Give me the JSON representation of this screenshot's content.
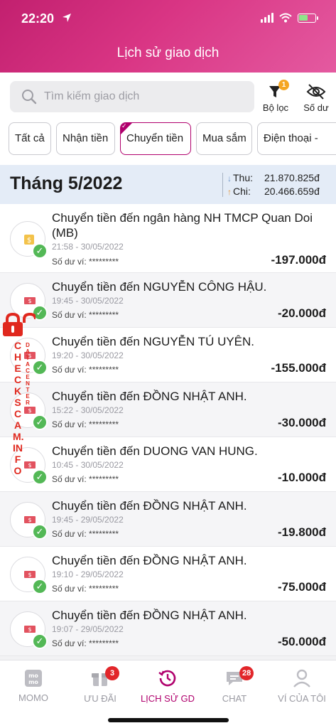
{
  "status_bar": {
    "time": "22:20"
  },
  "header": {
    "title": "Lịch sử giao dịch"
  },
  "search": {
    "placeholder": "Tìm kiếm giao dịch",
    "value": ""
  },
  "toolbar": {
    "filter_label": "Bộ lọc",
    "filter_badge": "1",
    "balance_label": "Số dư"
  },
  "chips": [
    {
      "label": "Tất cả",
      "active": false
    },
    {
      "label": "Nhận tiền",
      "active": false
    },
    {
      "label": "Chuyển tiền",
      "active": true
    },
    {
      "label": "Mua sắm",
      "active": false
    },
    {
      "label": "Điện thoại - ",
      "active": false
    }
  ],
  "month": {
    "title": "Tháng 5/2022",
    "income_label": "Thu:",
    "income_value": "21.870.825đ",
    "expense_label": "Chi:",
    "expense_value": "20.466.659đ"
  },
  "transactions": [
    {
      "title": "Chuyển tiền đến ngân hàng NH TMCP Quan Doi (MB)",
      "time": "21:58 - 30/05/2022",
      "balance": "Số dư ví: *********",
      "amount": "-197.000đ",
      "icon": "bank-icon"
    },
    {
      "title": "Chuyển tiền đến NGUYỄN CÔNG HẬU.",
      "time": "19:45 - 30/05/2022",
      "balance": "Số dư ví: *********",
      "amount": "-20.000đ",
      "icon": "money-transfer-icon"
    },
    {
      "title": "Chuyển tiền đến NGUYỄN TÚ UYÊN.",
      "time": "19:20 - 30/05/2022",
      "balance": "Số dư ví: *********",
      "amount": "-155.000đ",
      "icon": "money-transfer-icon"
    },
    {
      "title": "Chuyển tiền đến ĐỒNG NHẬT ANH.",
      "time": "15:22 - 30/05/2022",
      "balance": "Số dư ví: *********",
      "amount": "-30.000đ",
      "icon": "money-transfer-icon"
    },
    {
      "title": "Chuyển tiền đến DUONG VAN HUNG.",
      "time": "10:45 - 30/05/2022",
      "balance": "Số dư ví: *********",
      "amount": "-10.000đ",
      "icon": "money-transfer-icon"
    },
    {
      "title": "Chuyển tiền đến ĐỒNG NHẬT ANH.",
      "time": "19:45 - 29/05/2022",
      "balance": "Số dư ví: *********",
      "amount": "-19.800đ",
      "icon": "money-transfer-icon"
    },
    {
      "title": "Chuyển tiền đến ĐỒNG NHẬT ANH.",
      "time": "19:10 - 29/05/2022",
      "balance": "Số dư ví: *********",
      "amount": "-75.000đ",
      "icon": "money-transfer-icon"
    },
    {
      "title": "Chuyển tiền đến ĐỒNG NHẬT ANH.",
      "time": "19:07 - 29/05/2022",
      "balance": "Số dư ví: *********",
      "amount": "-50.000đ",
      "icon": "money-transfer-icon"
    }
  ],
  "watermark": {
    "main": "CHECKSCAM.INFO",
    "sub": "DATA CENTER"
  },
  "nav": [
    {
      "label": "MOMO",
      "icon": "momo-logo-icon",
      "badge": ""
    },
    {
      "label": "ƯU ĐÃI",
      "icon": "gift-icon",
      "badge": "3"
    },
    {
      "label": "LỊCH SỬ GD",
      "icon": "history-icon",
      "badge": "",
      "active": true
    },
    {
      "label": "CHAT",
      "icon": "chat-icon",
      "badge": "28"
    },
    {
      "label": "VÍ CỦA TÔI",
      "icon": "user-icon",
      "badge": ""
    }
  ],
  "colors": {
    "brand": "#b0006d",
    "header_gradient_start": "#c2206f",
    "success": "#53b856",
    "badge": "#e2262a"
  }
}
